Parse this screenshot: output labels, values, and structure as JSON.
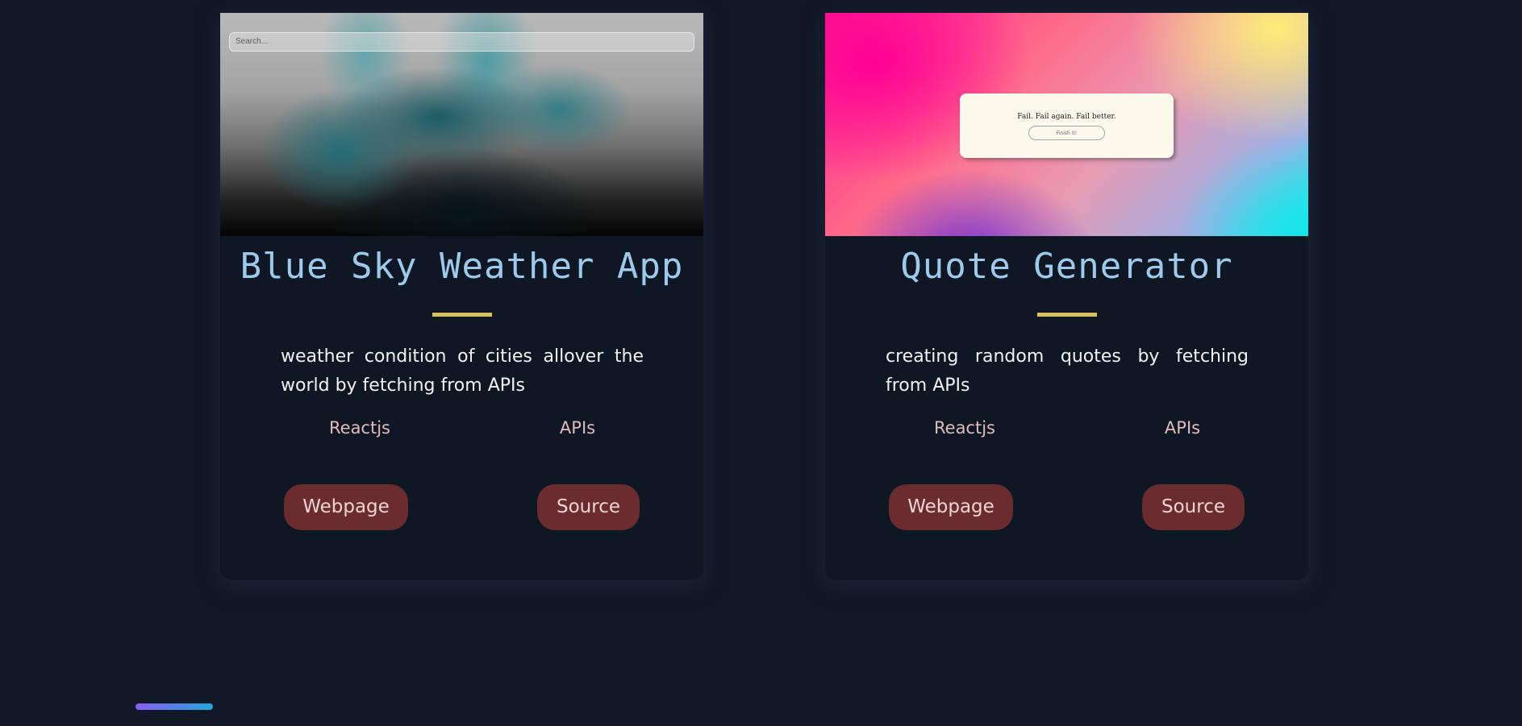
{
  "projects": [
    {
      "title": "Blue Sky Weather App",
      "thumbnail": {
        "search_placeholder": "Search..."
      },
      "description": "weather condition of cities allover the world by fetching from APIs",
      "tags": [
        "Reactjs",
        "APIs"
      ],
      "buttons": {
        "webpage": "Webpage",
        "source": "Source"
      }
    },
    {
      "title": "Quote Generator",
      "thumbnail": {
        "quote_text": "Fail. Fail again. Fail better.",
        "quote_button": "Finish it!"
      },
      "description": "creating random quotes by fetching from APIs",
      "tags": [
        "Reactjs",
        "APIs"
      ],
      "buttons": {
        "webpage": "Webpage",
        "source": "Source"
      }
    }
  ],
  "colors": {
    "background": "#111827",
    "card": "#0f1724",
    "title": "#9dc9ea",
    "divider": "#d8c25d",
    "button_bg": "#6a2c2e",
    "tag_text": "#e2bcbc"
  }
}
